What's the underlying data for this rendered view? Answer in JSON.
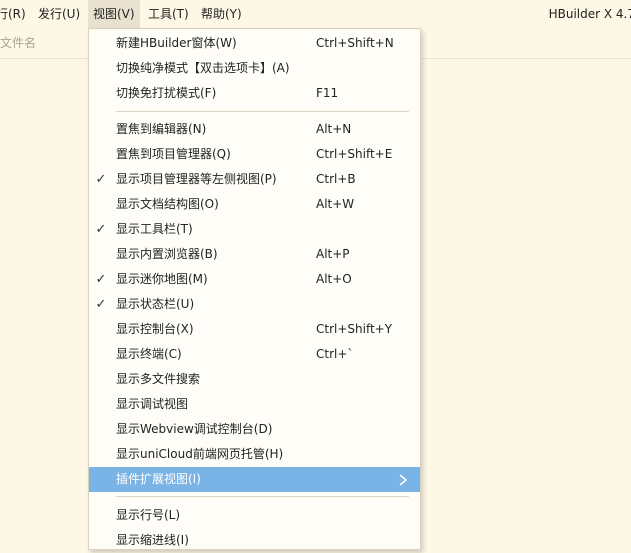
{
  "menubar": {
    "items": [
      {
        "label": "行(R)"
      },
      {
        "label": "发行(U)"
      },
      {
        "label": "视图(V)"
      },
      {
        "label": "工具(T)"
      },
      {
        "label": "帮助(Y)"
      }
    ],
    "app_title": "HBuilder X 4.7"
  },
  "tabbar": {
    "label": "文件名"
  },
  "view_menu": {
    "items": [
      {
        "label": "新建HBuilder窗体(W)",
        "shortcut": "Ctrl+Shift+N",
        "checked": false
      },
      {
        "label": "切换纯净模式【双击选项卡】(A)",
        "shortcut": "",
        "checked": false
      },
      {
        "label": "切换免打扰模式(F)",
        "shortcut": "F11",
        "checked": false
      },
      {
        "label": "置焦到编辑器(N)",
        "shortcut": "Alt+N",
        "checked": false
      },
      {
        "label": "置焦到项目管理器(Q)",
        "shortcut": "Ctrl+Shift+E",
        "checked": false
      },
      {
        "label": "显示项目管理器等左侧视图(P)",
        "shortcut": "Ctrl+B",
        "checked": true
      },
      {
        "label": "显示文档结构图(O)",
        "shortcut": "Alt+W",
        "checked": false
      },
      {
        "label": "显示工具栏(T)",
        "shortcut": "",
        "checked": true
      },
      {
        "label": "显示内置浏览器(B)",
        "shortcut": "Alt+P",
        "checked": false
      },
      {
        "label": "显示迷你地图(M)",
        "shortcut": "Alt+O",
        "checked": true
      },
      {
        "label": "显示状态栏(U)",
        "shortcut": "",
        "checked": true
      },
      {
        "label": "显示控制台(X)",
        "shortcut": "Ctrl+Shift+Y",
        "checked": false
      },
      {
        "label": "显示终端(C)",
        "shortcut": "Ctrl+`",
        "checked": false
      },
      {
        "label": "显示多文件搜索",
        "shortcut": "",
        "checked": false
      },
      {
        "label": "显示调试视图",
        "shortcut": "",
        "checked": false
      },
      {
        "label": "显示Webview调试控制台(D)",
        "shortcut": "",
        "checked": false
      },
      {
        "label": "显示uniCloud前端网页托管(H)",
        "shortcut": "",
        "checked": false
      },
      {
        "label": "插件扩展视图(I)",
        "shortcut": "",
        "checked": false,
        "highlighted": true,
        "has_submenu": true
      },
      {
        "label": "显示行号(L)",
        "shortcut": "",
        "checked": false
      },
      {
        "label": "显示缩进线(I)",
        "shortcut": "",
        "checked": false
      }
    ],
    "check_glyph": "✓"
  },
  "colors": {
    "background": "#fdf7e6",
    "menu_background": "#fffdf7",
    "highlight": "#7ab4e6"
  }
}
